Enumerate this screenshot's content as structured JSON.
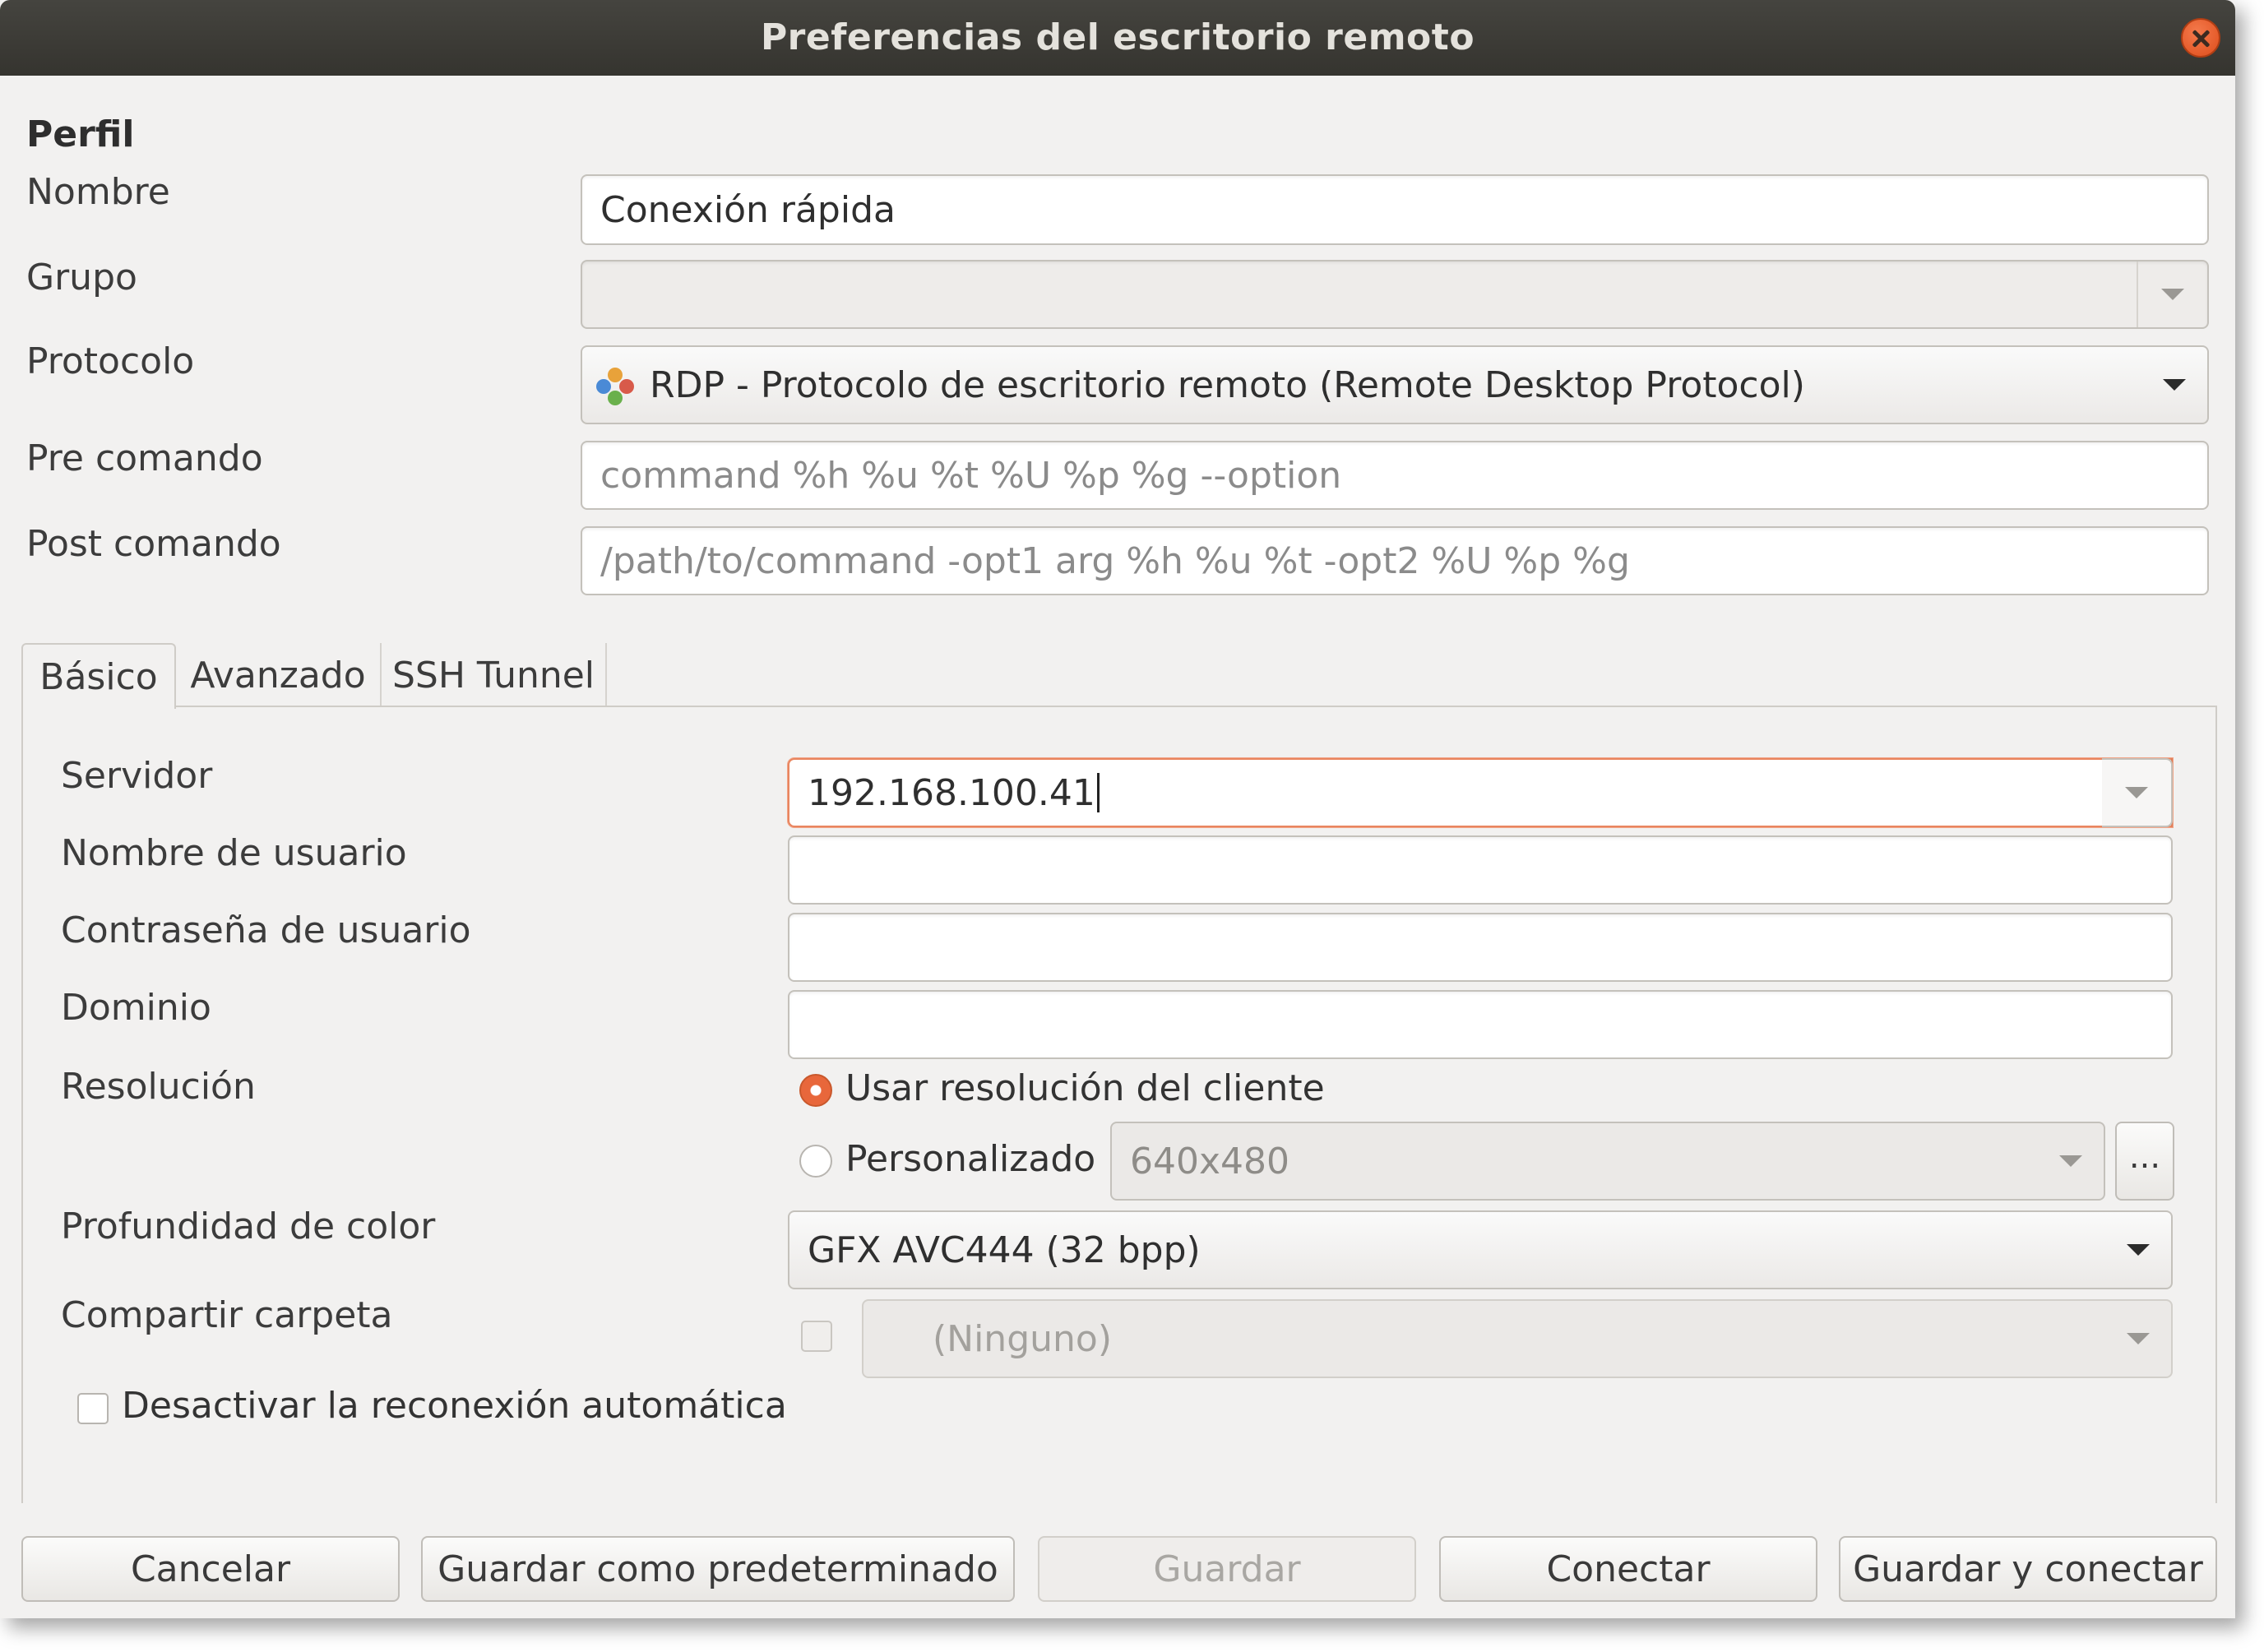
{
  "window": {
    "title": "Preferencias del escritorio remoto"
  },
  "profile": {
    "section_title": "Perfil",
    "name_label": "Nombre",
    "name_value": "Conexión rápida",
    "group_label": "Grupo",
    "group_value": "",
    "protocol_label": "Protocolo",
    "protocol_value": "RDP - Protocolo de escritorio remoto (Remote Desktop Protocol)",
    "pre_command_label": "Pre comando",
    "pre_command_placeholder": "command %h %u %t %U %p %g --option",
    "post_command_label": "Post comando",
    "post_command_placeholder": "/path/to/command -opt1 arg %h %u %t -opt2 %U %p %g"
  },
  "tabs": [
    {
      "label": "Básico",
      "active": true
    },
    {
      "label": "Avanzado",
      "active": false
    },
    {
      "label": "SSH Tunnel",
      "active": false
    }
  ],
  "basic": {
    "server_label": "Servidor",
    "server_value": "192.168.100.41",
    "username_label": "Nombre de usuario",
    "username_value": "",
    "password_label": "Contraseña de usuario",
    "password_value": "",
    "domain_label": "Dominio",
    "domain_value": "",
    "resolution_label": "Resolución",
    "resolution_client_label": "Usar resolución del cliente",
    "resolution_custom_label": "Personalizado",
    "resolution_custom_value": "640x480",
    "resolution_more_label": "...",
    "resolution_selected": "client",
    "color_depth_label": "Profundidad de color",
    "color_depth_value": "GFX AVC444 (32 bpp)",
    "share_folder_label": "Compartir carpeta",
    "share_folder_value": "(Ninguno)",
    "share_folder_checked": false,
    "disable_reconnect_label": "Desactivar la reconexión automática",
    "disable_reconnect_checked": false
  },
  "buttons": {
    "cancel": "Cancelar",
    "save_default": "Guardar como predeterminado",
    "save": "Guardar",
    "connect": "Conectar",
    "save_connect": "Guardar y conectar"
  },
  "colors": {
    "accent": "#e8673b",
    "titlebar": "#3c3b37",
    "window_bg": "#f2f1f0",
    "focus_border": "#e9855f"
  },
  "icons": {
    "close": "close-icon",
    "protocol": "rdp-protocol-icon",
    "dropdown": "chevron-down-icon"
  }
}
